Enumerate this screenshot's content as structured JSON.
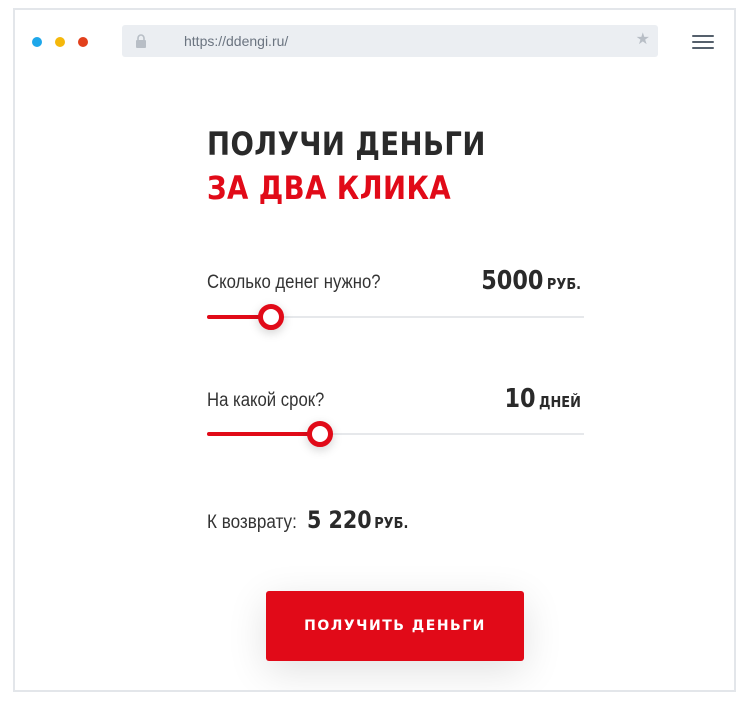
{
  "browser": {
    "url": "https://ddengi.ru/",
    "window_dots": [
      "#1ea7ea",
      "#f5b80b",
      "#e2401c"
    ],
    "icons": [
      "lock-icon",
      "star-icon",
      "hamburger-menu-icon"
    ]
  },
  "hero": {
    "title_line1": "ПОЛУЧИ ДЕНЬГИ",
    "title_line2": "ЗА ДВА КЛИКА"
  },
  "amount": {
    "label": "Сколько денег нужно?",
    "value": "5000",
    "unit": "РУБ.",
    "slider_fill": 0.17
  },
  "term": {
    "label": "На какой срок?",
    "value": "10",
    "unit": "ДНЕЙ",
    "slider_fill": 0.3
  },
  "repayment": {
    "label": "К возврату:",
    "value": "5 220",
    "unit": "РУБ."
  },
  "cta": {
    "label": "ПОЛУЧИТЬ ДЕНЬГИ"
  },
  "colors": {
    "accent": "#e10a18",
    "text_dark": "#2a2a2a",
    "urlbar_bg": "#ebeef2",
    "track": "#e6e8eb"
  }
}
